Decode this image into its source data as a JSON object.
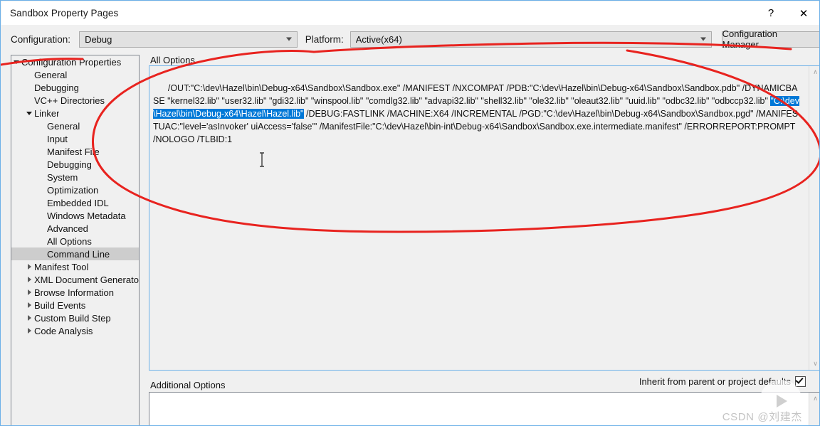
{
  "window": {
    "title": "Sandbox Property Pages",
    "help_label": "?",
    "close_label": "✕"
  },
  "config_row": {
    "configuration_label": "Configuration:",
    "configuration_value": "Debug",
    "platform_label": "Platform:",
    "platform_value": "Active(x64)",
    "configuration_manager_label": "Configuration Manager..."
  },
  "tree": {
    "items": [
      {
        "label": "Configuration Properties",
        "indent": 0,
        "twisty": "expanded",
        "selected": false
      },
      {
        "label": "General",
        "indent": 1,
        "twisty": "none",
        "selected": false
      },
      {
        "label": "Debugging",
        "indent": 1,
        "twisty": "none",
        "selected": false
      },
      {
        "label": "VC++ Directories",
        "indent": 1,
        "twisty": "none",
        "selected": false
      },
      {
        "label": "Linker",
        "indent": 1,
        "twisty": "expanded",
        "selected": false
      },
      {
        "label": "General",
        "indent": 2,
        "twisty": "none",
        "selected": false
      },
      {
        "label": "Input",
        "indent": 2,
        "twisty": "none",
        "selected": false
      },
      {
        "label": "Manifest File",
        "indent": 2,
        "twisty": "none",
        "selected": false
      },
      {
        "label": "Debugging",
        "indent": 2,
        "twisty": "none",
        "selected": false
      },
      {
        "label": "System",
        "indent": 2,
        "twisty": "none",
        "selected": false
      },
      {
        "label": "Optimization",
        "indent": 2,
        "twisty": "none",
        "selected": false
      },
      {
        "label": "Embedded IDL",
        "indent": 2,
        "twisty": "none",
        "selected": false
      },
      {
        "label": "Windows Metadata",
        "indent": 2,
        "twisty": "none",
        "selected": false
      },
      {
        "label": "Advanced",
        "indent": 2,
        "twisty": "none",
        "selected": false
      },
      {
        "label": "All Options",
        "indent": 2,
        "twisty": "none",
        "selected": false
      },
      {
        "label": "Command Line",
        "indent": 2,
        "twisty": "none",
        "selected": true
      },
      {
        "label": "Manifest Tool",
        "indent": 1,
        "twisty": "collapsed",
        "selected": false
      },
      {
        "label": "XML Document Generator",
        "indent": 1,
        "twisty": "collapsed",
        "selected": false
      },
      {
        "label": "Browse Information",
        "indent": 1,
        "twisty": "collapsed",
        "selected": false
      },
      {
        "label": "Build Events",
        "indent": 1,
        "twisty": "collapsed",
        "selected": false
      },
      {
        "label": "Custom Build Step",
        "indent": 1,
        "twisty": "collapsed",
        "selected": false
      },
      {
        "label": "Code Analysis",
        "indent": 1,
        "twisty": "collapsed",
        "selected": false
      }
    ]
  },
  "all_options": {
    "label": "All Options",
    "text_before_selection": "/OUT:\"C:\\dev\\Hazel\\bin\\Debug-x64\\Sandbox\\Sandbox.exe\" /MANIFEST /NXCOMPAT /PDB:\"C:\\dev\\Hazel\\bin\\Debug-x64\\Sandbox\\Sandbox.pdb\" /DYNAMICBASE \"kernel32.lib\" \"user32.lib\" \"gdi32.lib\" \"winspool.lib\" \"comdlg32.lib\" \"advapi32.lib\" \"shell32.lib\" \"ole32.lib\" \"oleaut32.lib\" \"uuid.lib\" \"odbc32.lib\" \"odbccp32.lib\" ",
    "selected_text": "\"C:\\dev\\Hazel\\bin\\Debug-x64\\Hazel\\Hazel.lib\"",
    "text_after_selection": " /DEBUG:FASTLINK /MACHINE:X64 /INCREMENTAL /PGD:\"C:\\dev\\Hazel\\bin\\Debug-x64\\Sandbox\\Sandbox.pgd\" /MANIFESTUAC:\"level='asInvoker' uiAccess='false'\" /ManifestFile:\"C:\\dev\\Hazel\\bin-int\\Debug-x64\\Sandbox\\Sandbox.exe.intermediate.manifest\" /ERRORREPORT:PROMPT /NOLOGO /TLBID:1",
    "scroll_up_glyph": "∧",
    "scroll_down_glyph": "∨"
  },
  "additional_options": {
    "label": "Additional Options",
    "value": "",
    "inherit_label": "Inherit from parent or project defaults",
    "inherit_checked": true,
    "scroll_up_glyph": "∧"
  },
  "watermark": {
    "text": "CSDN @刘建杰"
  },
  "annotation": {
    "color": "#e8231f",
    "shape": "hand-drawn-ellipse",
    "stroke_width": 3
  }
}
